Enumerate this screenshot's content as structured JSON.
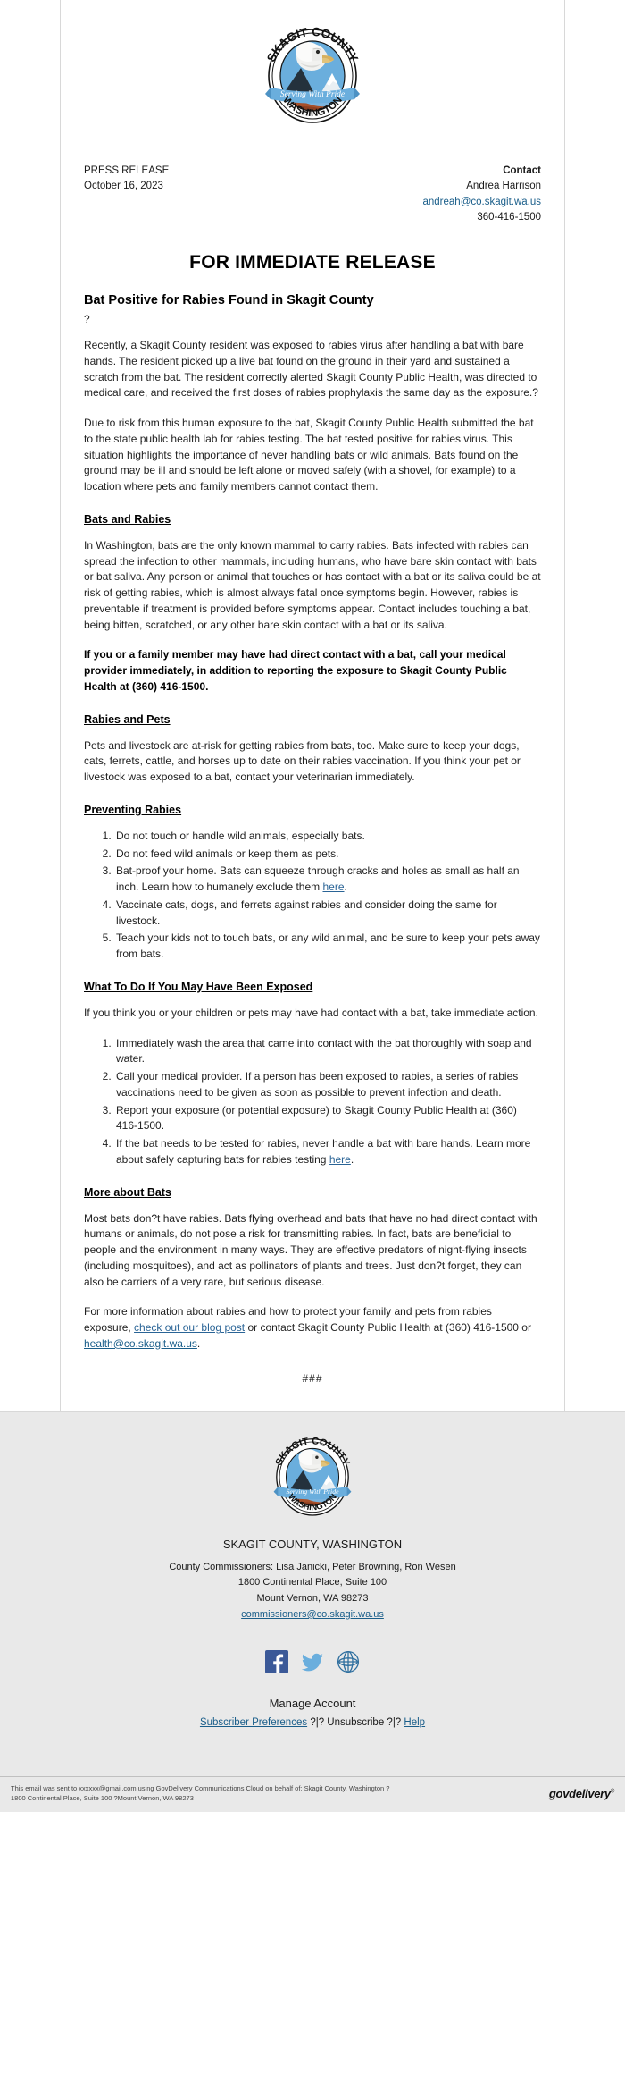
{
  "logo": {
    "top_text": "SKAGIT COUNTY",
    "bottom_text": "WASHINGTON",
    "banner_text": "Serving With Pride",
    "alt": "skagit-county-seal"
  },
  "press_release": {
    "label": "PRESS RELEASE",
    "date": "October 16, 2023",
    "contact_label": "Contact",
    "contact_name": "Andrea Harrison",
    "contact_email": "andreah@co.skagit.wa.us",
    "contact_phone": "360-416-1500"
  },
  "headline": "FOR IMMEDIATE RELEASE",
  "subheadline": "Bat Positive for Rabies Found in Skagit County",
  "stray_char": "?",
  "paragraphs": {
    "p1": "Recently, a Skagit County resident was exposed to rabies virus after handling a bat with bare hands. The resident picked up a live bat found on the ground in their yard and sustained a scratch from the bat. The resident correctly alerted Skagit County Public Health, was directed to medical care, and received the first doses of rabies prophylaxis the same day as the exposure.?",
    "p2": "Due to risk from this human exposure to the bat, Skagit County Public Health submitted the bat to the state public health lab for rabies testing. The bat tested positive for rabies virus. This situation highlights the importance of never handling bats or wild animals. Bats found on the ground may be ill and should be left alone or moved safely (with a shovel, for example) to a location where pets and family members cannot contact them."
  },
  "sections": {
    "bats_and_rabies": {
      "heading": "Bats and Rabies",
      "body": "In Washington, bats are the only known mammal to carry rabies. Bats infected with rabies can spread the infection to other mammals, including humans, who have bare skin contact with bats or bat saliva. Any person or animal that touches or has contact with a bat or its saliva could be at risk of getting rabies, which is almost always fatal once symptoms begin. However, rabies is preventable if treatment is provided before symptoms appear. Contact includes touching a bat, being bitten, scratched, or any other bare skin contact with a bat or its saliva.",
      "callout": "If you or a family member may have had direct contact with a bat, call your medical provider immediately, in addition to reporting the exposure to Skagit County Public Health at (360) 416-1500."
    },
    "rabies_and_pets": {
      "heading": "Rabies and Pets",
      "body": "Pets and livestock are at-risk for getting rabies from bats, too. Make sure to keep your dogs, cats, ferrets, cattle, and horses up to date on their rabies vaccination. If you think your pet or livestock was exposed to a bat, contact your veterinarian immediately."
    },
    "preventing_rabies": {
      "heading": "Preventing Rabies",
      "items": [
        {
          "pre": "Do not touch or handle wild animals, especially bats.",
          "link": "",
          "post": ""
        },
        {
          "pre": "Do not feed wild animals or keep them as pets.",
          "link": "",
          "post": ""
        },
        {
          "pre": "Bat-proof your home. Bats can squeeze through cracks and holes as small as half an inch. Learn how to humanely exclude them ",
          "link": "here",
          "post": "."
        },
        {
          "pre": "Vaccinate cats, dogs, and ferrets against rabies and consider doing the same for livestock.",
          "link": "",
          "post": ""
        },
        {
          "pre": "Teach your kids not to touch bats, or any wild animal, and be sure to keep your pets away from bats.",
          "link": "",
          "post": ""
        }
      ]
    },
    "exposed": {
      "heading": "What To Do If You May Have Been Exposed",
      "intro": "If you think you or your children or pets may have had contact with a bat, take immediate action.",
      "items": [
        {
          "pre": "Immediately wash the area that came into contact with the bat thoroughly with soap and water.",
          "link": "",
          "post": ""
        },
        {
          "pre": "Call your medical provider. If a person has been exposed to rabies, a series of rabies vaccinations need to be given as soon as possible to prevent infection and death.",
          "link": "",
          "post": ""
        },
        {
          "pre": "Report your exposure (or potential exposure) to Skagit County Public Health at (360) 416-1500.",
          "link": "",
          "post": ""
        },
        {
          "pre": "If the bat needs to be tested for rabies, never handle a bat with bare hands. Learn more about safely capturing bats for rabies testing ",
          "link": "here",
          "post": "."
        }
      ]
    },
    "more_about_bats": {
      "heading": "More about Bats",
      "body": "Most bats don?t have rabies. Bats flying overhead and bats that have no had direct contact with humans or animals, do not pose a risk for transmitting rabies. In fact, bats are beneficial to people and the environment in many ways. They are effective predators of night-flying insects (including mosquitoes), and act as pollinators of plants and trees. Just don?t forget, they can also be carriers of a very rare, but serious disease.",
      "closing_pre": "For more information about rabies and how to protect your family and pets from rabies exposure, ",
      "closing_link1": "check out our blog post",
      "closing_mid": " or contact Skagit County Public Health at (360) 416-1500 or ",
      "closing_link2": "health@co.skagit.wa.us",
      "closing_post": "."
    }
  },
  "end_marker": "###",
  "footer": {
    "org_name": "SKAGIT COUNTY, WASHINGTON",
    "commissioners": "County Commissioners: Lisa Janicki, Peter Browning, Ron Wesen",
    "address1": "1800 Continental Place, Suite 100",
    "address2": "Mount Vernon, WA 98273",
    "email": "commissioners@co.skagit.wa.us",
    "social": [
      {
        "name": "facebook-icon",
        "label": "Facebook"
      },
      {
        "name": "twitter-icon",
        "label": "Twitter"
      },
      {
        "name": "globe-icon",
        "label": "Website"
      }
    ],
    "manage_title": "Manage Account",
    "link_preferences": "Subscriber Preferences",
    "sep1": "?|?",
    "link_unsubscribe": "Unsubscribe",
    "sep2": "?|?",
    "link_help": "Help",
    "legal_line1": "This email was sent to xxxxxx@gmail.com using GovDelivery Communications Cloud on behalf of: Skagit County, Washington ?",
    "legal_line2": "1800 Continental Place, Suite 100 ?Mount Vernon, WA 98273",
    "brand": "govdelivery",
    "brand_sup": "®"
  },
  "colors": {
    "link": "#1a5e8a",
    "blue_link": "#2a6496",
    "footer_bg": "#e9e9e9",
    "seal_blue": "#6aaedd",
    "facebook": "#3b5998",
    "twitter": "#6aaedd",
    "globe": "#2f6f9f"
  }
}
